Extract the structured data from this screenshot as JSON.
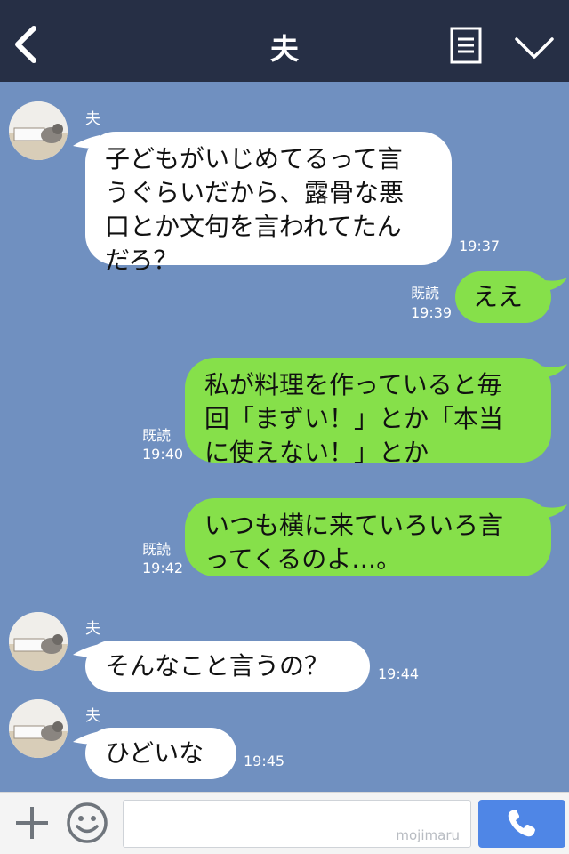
{
  "header": {
    "title": "夫"
  },
  "messages": [
    {
      "sender": "夫",
      "text": "子どもがいじめてるって言\nうぐらいだから、露骨な悪\n口とか文句を言われてたん\nだろ？",
      "time": "19:37"
    },
    {
      "read": "既読",
      "text": "ええ",
      "time": "19:39"
    },
    {
      "read": "既読",
      "text": "私が料理を作っていると毎\n回「まずい！」とか「本当\nに使えない！」とか",
      "time": "19:40"
    },
    {
      "read": "既読",
      "text": "いつも横に来ていろいろ言\nってくるのよ…。",
      "time": "19:42"
    },
    {
      "sender": "夫",
      "text": "そんなこと言うの？",
      "time": "19:44"
    },
    {
      "sender": "夫",
      "text": "ひどいな",
      "time": "19:45"
    }
  ],
  "footer": {
    "watermark": "mojimaru"
  },
  "colors": {
    "header_bg": "#262f45",
    "chat_bg": "#7090c0",
    "outgoing_bubble": "#86e04a",
    "incoming_bubble": "#ffffff",
    "call_button": "#4f86e6"
  },
  "icons": {
    "back": "chevron-left-icon",
    "memo": "note-icon",
    "menu": "chevron-down-icon",
    "add": "plus-icon",
    "sticker": "smiley-icon",
    "call": "phone-icon"
  }
}
